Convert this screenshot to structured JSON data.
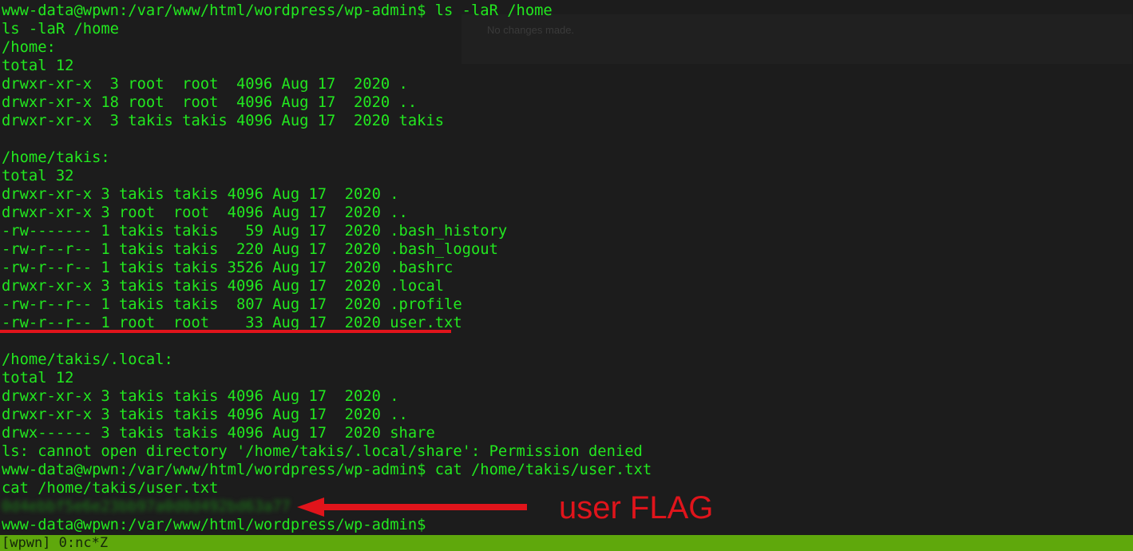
{
  "background_panel": {
    "text": "No changes made."
  },
  "terminal": {
    "text_color": "#22e81f",
    "background_color": "#1c1c1c",
    "lines": [
      "www-data@wpwn:/var/www/html/wordpress/wp-admin$ ls -laR /home",
      "ls -laR /home",
      "/home:",
      "total 12",
      "drwxr-xr-x  3 root  root  4096 Aug 17  2020 .",
      "drwxr-xr-x 18 root  root  4096 Aug 17  2020 ..",
      "drwxr-xr-x  3 takis takis 4096 Aug 17  2020 takis",
      "",
      "/home/takis:",
      "total 32",
      "drwxr-xr-x 3 takis takis 4096 Aug 17  2020 .",
      "drwxr-xr-x 3 root  root  4096 Aug 17  2020 ..",
      "-rw------- 1 takis takis   59 Aug 17  2020 .bash_history",
      "-rw-r--r-- 1 takis takis  220 Aug 17  2020 .bash_logout",
      "-rw-r--r-- 1 takis takis 3526 Aug 17  2020 .bashrc",
      "drwxr-xr-x 3 takis takis 4096 Aug 17  2020 .local",
      "-rw-r--r-- 1 takis takis  807 Aug 17  2020 .profile",
      "-rw-r--r-- 1 root  root    33 Aug 17  2020 user.txt",
      "",
      "/home/takis/.local:",
      "total 12",
      "drwxr-xr-x 3 takis takis 4096 Aug 17  2020 .",
      "drwxr-xr-x 3 takis takis 4096 Aug 17  2020 ..",
      "drwx------ 3 takis takis 4096 Aug 17  2020 share",
      "ls: cannot open directory '/home/takis/.local/share': Permission denied",
      "www-data@wpwn:/var/www/html/wordpress/wp-admin$ cat /home/takis/user.txt",
      "cat /home/takis/user.txt",
      "0d4ebbf5e6e23bb97a0d0d492bd63a77",
      "www-data@wpwn:/var/www/html/wordpress/wp-admin$"
    ],
    "flag_line_index": 27
  },
  "annotation": {
    "label": "user FLAG",
    "color": "#e0141b"
  },
  "status_bar": {
    "text": "[wpwn] 0:nc*Z",
    "color": "#5fa80c"
  }
}
